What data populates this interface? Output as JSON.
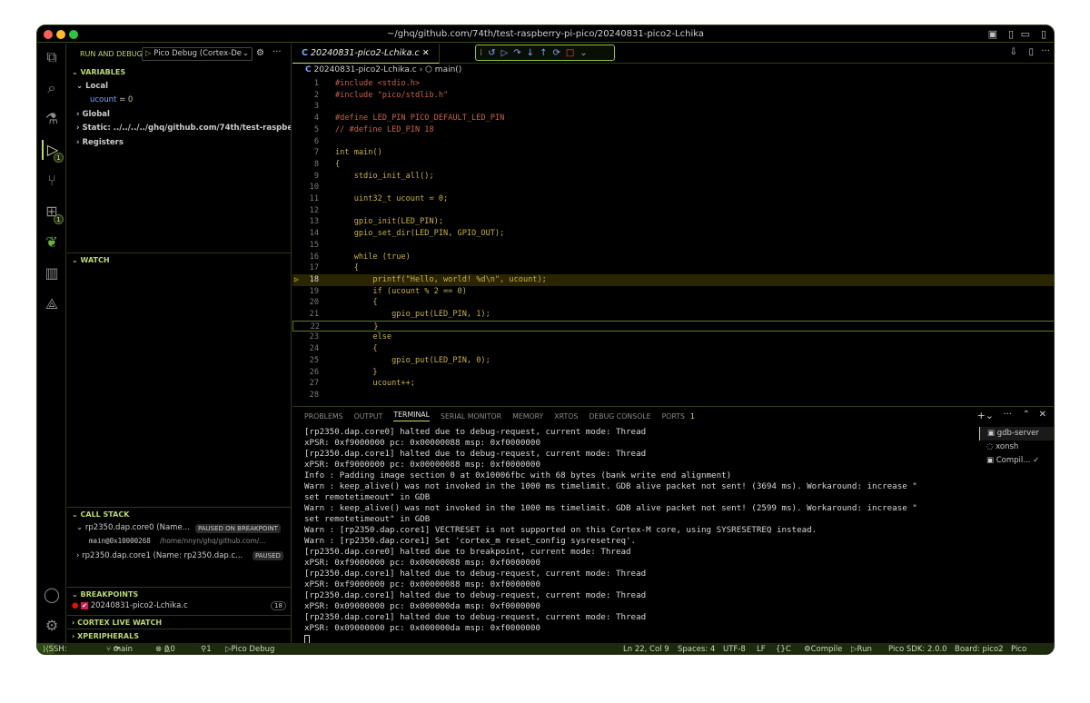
{
  "window": {
    "title": "~/ghq/github.com/74th/test-raspberry-pi-pico/20240831-pico2-Lchika"
  },
  "sidebar": {
    "header": "RUN AND DEBUG",
    "config": "Pico Debug (Cortex-De",
    "variables": {
      "title": "VARIABLES",
      "local": "Local",
      "local_var_name": "ucount",
      "local_var_value": "0",
      "global": "Global",
      "static": "Static: ../../../../ghq/github.com/74th/test-raspberry-pi-pi",
      "registers": "Registers"
    },
    "watch": {
      "title": "WATCH"
    },
    "callstack": {
      "title": "CALL STACK",
      "thread0": "rp2350.dap.core0 (Name...",
      "thread0_state": "PAUSED ON BREAKPOINT",
      "frame_name": "main@0x10000268",
      "frame_path": "/home/nnyn/ghq/github.com/...",
      "thread1": "rp2350.dap.core1 (Name: rp2350.dap.c...",
      "thread1_state": "PAUSED"
    },
    "breakpoints": {
      "title": "BREAKPOINTS",
      "file": "20240831-pico2-Lchika.c",
      "line": "18"
    },
    "cortex_live_watch": "CORTEX LIVE WATCH",
    "xperipherals": "XPERIPHERALS"
  },
  "activity": {
    "debug_badge": "1",
    "ext_badge": "1"
  },
  "editor": {
    "tab": "20240831-pico2-Lchika.c",
    "breadcrumb_file": "20240831-pico2-Lchika.c",
    "breadcrumb_symbol": "main()",
    "lines": [
      {
        "n": "1",
        "t": "#include <stdio.h>"
      },
      {
        "n": "2",
        "t": "#include \"pico/stdlib.h\""
      },
      {
        "n": "3",
        "t": ""
      },
      {
        "n": "4",
        "t": "#define LED_PIN PICO_DEFAULT_LED_PIN"
      },
      {
        "n": "5",
        "t": "// #define LED_PIN 18"
      },
      {
        "n": "6",
        "t": ""
      },
      {
        "n": "7",
        "t": "int main()"
      },
      {
        "n": "8",
        "t": "{"
      },
      {
        "n": "9",
        "t": "    stdio_init_all();"
      },
      {
        "n": "10",
        "t": ""
      },
      {
        "n": "11",
        "t": "    uint32_t ucount = 0;"
      },
      {
        "n": "12",
        "t": ""
      },
      {
        "n": "13",
        "t": "    gpio_init(LED_PIN);"
      },
      {
        "n": "14",
        "t": "    gpio_set_dir(LED_PIN, GPIO_OUT);"
      },
      {
        "n": "15",
        "t": ""
      },
      {
        "n": "16",
        "t": "    while (true)"
      },
      {
        "n": "17",
        "t": "    {"
      },
      {
        "n": "18",
        "t": "        printf(\"Hello, world! %d\\n\", ucount);"
      },
      {
        "n": "19",
        "t": "        if (ucount % 2 == 0)"
      },
      {
        "n": "20",
        "t": "        {"
      },
      {
        "n": "21",
        "t": "            gpio_put(LED_PIN, 1);"
      },
      {
        "n": "22",
        "t": "        }"
      },
      {
        "n": "23",
        "t": "        else"
      },
      {
        "n": "24",
        "t": "        {"
      },
      {
        "n": "25",
        "t": "            gpio_put(LED_PIN, 0);"
      },
      {
        "n": "26",
        "t": "        }"
      },
      {
        "n": "27",
        "t": "        ucount++;"
      },
      {
        "n": "28",
        "t": ""
      }
    ]
  },
  "panel": {
    "tabs": [
      "PROBLEMS",
      "OUTPUT",
      "TERMINAL",
      "SERIAL MONITOR",
      "MEMORY",
      "XRTOS",
      "DEBUG CONSOLE",
      "PORTS"
    ],
    "ports_badge": "1",
    "terminal_lines": [
      "[rp2350.dap.core0] halted due to debug-request, current mode: Thread",
      "xPSR: 0xf9000000 pc: 0x00000088 msp: 0xf0000000",
      "[rp2350.dap.core1] halted due to debug-request, current mode: Thread",
      "xPSR: 0xf9000000 pc: 0x00000088 msp: 0xf0000000",
      "Info : Padding image section 0 at 0x10006fbc with 68 bytes (bank write end alignment)",
      "Warn : keep_alive() was not invoked in the 1000 ms timelimit. GDB alive packet not sent! (3694 ms). Workaround: increase \"",
      "set remotetimeout\" in GDB",
      "Warn : keep_alive() was not invoked in the 1000 ms timelimit. GDB alive packet not sent! (2599 ms). Workaround: increase \"",
      "set remotetimeout\" in GDB",
      "Warn : [rp2350.dap.core1] VECTRESET is not supported on this Cortex-M core, using SYSRESETREQ instead.",
      "Warn : [rp2350.dap.core1] Set 'cortex_m reset_config sysresetreq'.",
      "[rp2350.dap.core0] halted due to breakpoint, current mode: Thread",
      "xPSR: 0xf9000000 pc: 0x00000088 msp: 0xf0000000",
      "[rp2350.dap.core1] halted due to debug-request, current mode: Thread",
      "xPSR: 0xf9000000 pc: 0x00000088 msp: 0xf0000000",
      "[rp2350.dap.core1] halted due to debug-request, current mode: Thread",
      "xPSR: 0x09000000 pc: 0x000000da msp: 0xf0000000",
      "[rp2350.dap.core1] halted due to debug-request, current mode: Thread",
      "xPSR: 0x09000000 pc: 0x000000da msp: 0xf0000000"
    ],
    "terminals": [
      "gdb-server",
      "xonsh",
      "Compil..."
    ]
  },
  "status": {
    "remote": "SSH: nonoa",
    "branch": "main",
    "errors": "0",
    "warnings": "0",
    "ports": "1",
    "debug": "Pico Debug (Cortex-Debug) (20240831-pico2-Lchika)",
    "position": "Ln 22, Col 9",
    "spaces": "Spaces: 4",
    "encoding": "UTF-8",
    "eol": "LF",
    "lang": "C",
    "compile": "Compile",
    "run": "Run",
    "sdk": "Pico SDK: 2.0.0",
    "board": "Board: pico2",
    "pico": "Pico"
  }
}
